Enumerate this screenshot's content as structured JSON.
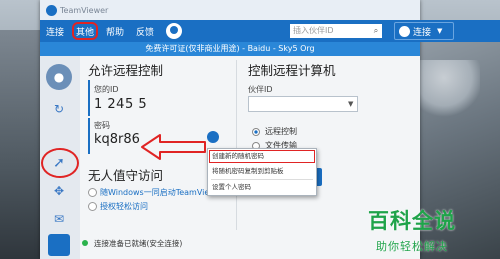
{
  "window": {
    "title": "TeamViewer"
  },
  "menu": {
    "items": [
      "连接",
      "其他",
      "帮助",
      "反馈"
    ],
    "search_placeholder": "插入伙伴ID",
    "search_icon": "search-icon",
    "connect_label": "连接"
  },
  "license_bar": "免费许可证(仅非商业用途) - Baidu - Sky5  Org",
  "left": {
    "title": "允许远程控制",
    "id_label": "您的ID",
    "id_value": "1 245 5",
    "pwd_label": "密码",
    "pwd_value": "kq8r86"
  },
  "unattended": {
    "title": "无人值守访问",
    "item1": "随Windows一同启动TeamViewer",
    "item2": "授权轻松访问"
  },
  "right": {
    "title": "控制远程计算机",
    "partner_label": "伙伴ID",
    "radio1": "远程控制",
    "radio2": "文件传输"
  },
  "context_menu": {
    "item1": "创建新的随机密码",
    "item2": "将随机密码复制到剪贴板",
    "item3": "设置个人密码"
  },
  "status": "连接准备已就绪(安全连接)",
  "watermark": {
    "big": "百科全说",
    "small": "助你轻松解决"
  },
  "colors": {
    "accent": "#1a6fc3",
    "annotation": "#e02424",
    "watermark": "#1fa34a"
  }
}
